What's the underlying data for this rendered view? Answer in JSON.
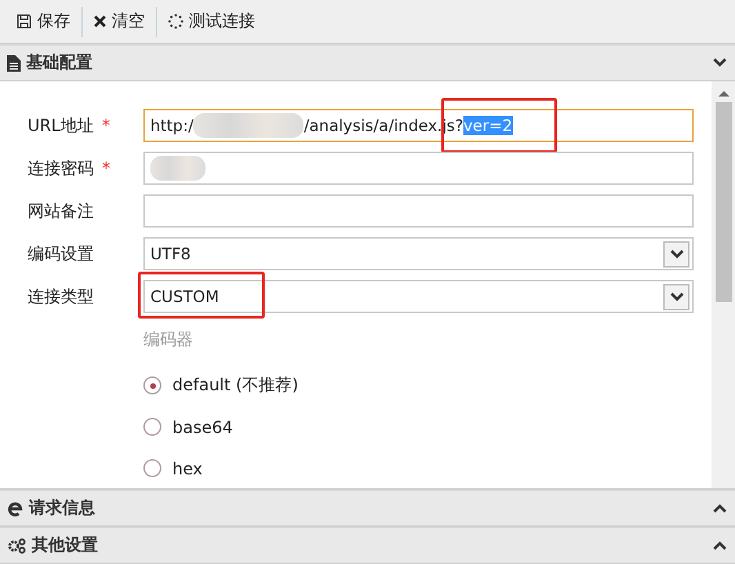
{
  "toolbar": [
    {
      "kind": "save",
      "label": "保存"
    },
    {
      "kind": "clear",
      "label": "清空"
    },
    {
      "kind": "test",
      "label": "测试连接"
    }
  ],
  "sections": [
    {
      "kind": "doc",
      "title": "基础配置",
      "expanded": true
    },
    {
      "kind": "request",
      "title": "请求信息",
      "expanded": false
    },
    {
      "kind": "gear",
      "title": "其他设置",
      "expanded": false
    }
  ],
  "form": {
    "fields": [
      {
        "kind": "url",
        "label": "URL地址",
        "required_mark": "*",
        "focused": true,
        "highlight": true,
        "value_start": "http:/",
        "value_end": "/analysis/a/index.js?",
        "selected_text": "ver=2"
      },
      {
        "kind": "secret",
        "label": "连接密码",
        "required_mark": "*",
        "focused": false,
        "highlight": false
      },
      {
        "kind": "text",
        "label": "网站备注",
        "focused": false,
        "highlight": false
      },
      {
        "kind": "select",
        "label": "编码设置",
        "focused": false,
        "highlight": false,
        "value": "UTF8"
      },
      {
        "kind": "select",
        "label": "连接类型",
        "focused": false,
        "highlight": true,
        "value": "CUSTOM"
      }
    ],
    "encoder": {
      "label": "编码器",
      "options": [
        {
          "label": "default (不推荐)",
          "selected": true
        },
        {
          "label": "base64",
          "selected": false
        },
        {
          "label": "hex",
          "selected": false
        }
      ]
    }
  }
}
